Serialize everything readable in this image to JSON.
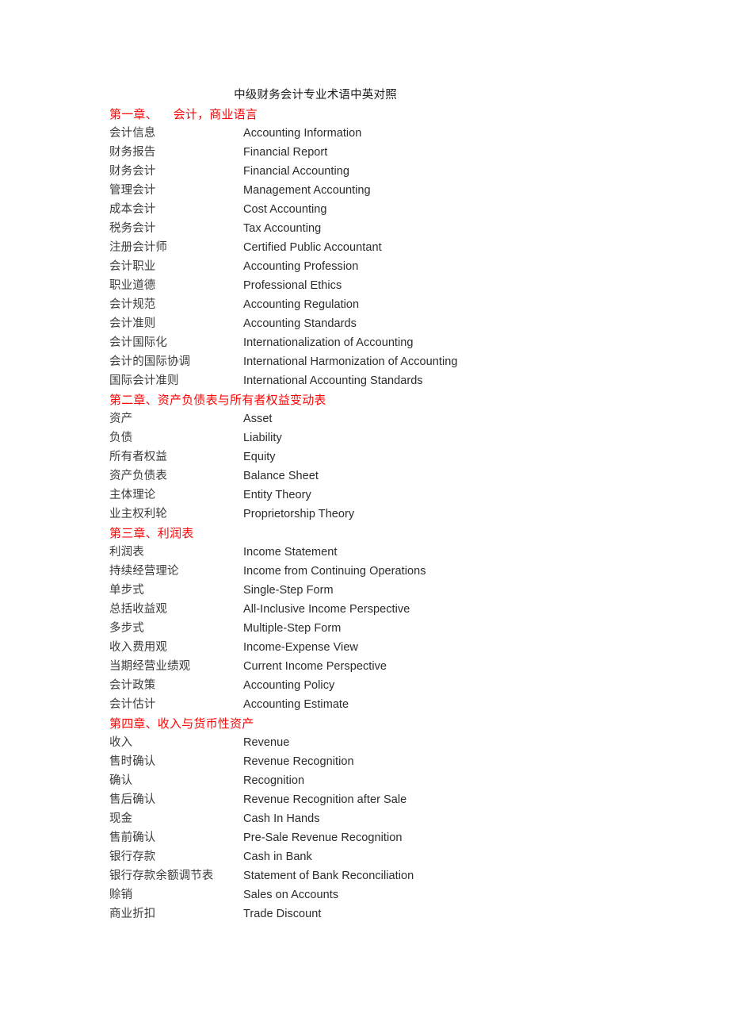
{
  "document": {
    "title": "中级财务会计专业术语中英对照",
    "heading_color": "#FA0505",
    "body_color": "#3B3B3B"
  },
  "sections": [
    {
      "heading": "第一章、    会计，商业语言",
      "rows": [
        {
          "cn": "会计信息",
          "en": "Accounting Information"
        },
        {
          "cn": "财务报告",
          "en": "Financial Report"
        },
        {
          "cn": "财务会计",
          "en": "Financial Accounting"
        },
        {
          "cn": "管理会计",
          "en": "Management Accounting"
        },
        {
          "cn": "成本会计",
          "en": "Cost Accounting"
        },
        {
          "cn": "税务会计",
          "en": "Tax Accounting"
        },
        {
          "cn": "注册会计师",
          "en": "Certified Public Accountant"
        },
        {
          "cn": "会计职业",
          "en": "Accounting Profession"
        },
        {
          "cn": "职业道德",
          "en": "Professional Ethics"
        },
        {
          "cn": "会计规范",
          "en": "Accounting Regulation"
        },
        {
          "cn": "会计准则",
          "en": "Accounting Standards"
        },
        {
          "cn": "会计国际化",
          "en": "Internationalization of Accounting"
        },
        {
          "cn": "会计的国际协调",
          "en": "International Harmonization of Accounting"
        },
        {
          "cn": "国际会计准则",
          "en": "International Accounting Standards"
        }
      ]
    },
    {
      "heading": "第二章、资产负债表与所有者权益变动表",
      "rows": [
        {
          "cn": "资产",
          "en": "Asset"
        },
        {
          "cn": "负债",
          "en": "Liability"
        },
        {
          "cn": "所有者权益",
          "en": "Equity"
        },
        {
          "cn": "资产负债表",
          "en": "Balance Sheet"
        },
        {
          "cn": "主体理论",
          "en": "Entity Theory"
        },
        {
          "cn": "业主权利轮",
          "en": "Proprietorship Theory"
        }
      ]
    },
    {
      "heading": "第三章、利润表",
      "rows": [
        {
          "cn": "利润表",
          "en": "Income Statement"
        },
        {
          "cn": "持续经营理论",
          "en": "Income from Continuing Operations"
        },
        {
          "cn": "单步式",
          "en": "Single-Step Form"
        },
        {
          "cn": "总括收益观",
          "en": "All-Inclusive Income Perspective"
        },
        {
          "cn": "多步式",
          "en": "Multiple-Step Form"
        },
        {
          "cn": "收入费用观",
          "en": "Income-Expense View"
        },
        {
          "cn": "当期经营业绩观",
          "en": "Current Income Perspective"
        },
        {
          "cn": "会计政策",
          "en": "Accounting Policy"
        },
        {
          "cn": "会计估计",
          "en": "Accounting Estimate"
        }
      ]
    },
    {
      "heading": "第四章、收入与货币性资产",
      "rows": [
        {
          "cn": "收入",
          "en": "Revenue"
        },
        {
          "cn": "售时确认",
          "en": "Revenue Recognition"
        },
        {
          "cn": "确认",
          "en": "Recognition"
        },
        {
          "cn": "售后确认",
          "en": "Revenue Recognition after Sale"
        },
        {
          "cn": "现金",
          "en": "Cash In Hands"
        },
        {
          "cn": "售前确认",
          "en": "Pre-Sale Revenue Recognition"
        },
        {
          "cn": "银行存款",
          "en": "Cash in Bank"
        },
        {
          "cn": "银行存款余额调节表",
          "en": "Statement of Bank Reconciliation"
        },
        {
          "cn": "赊销",
          "en": "Sales on Accounts"
        },
        {
          "cn": "商业折扣",
          "en": "Trade Discount"
        }
      ]
    }
  ]
}
